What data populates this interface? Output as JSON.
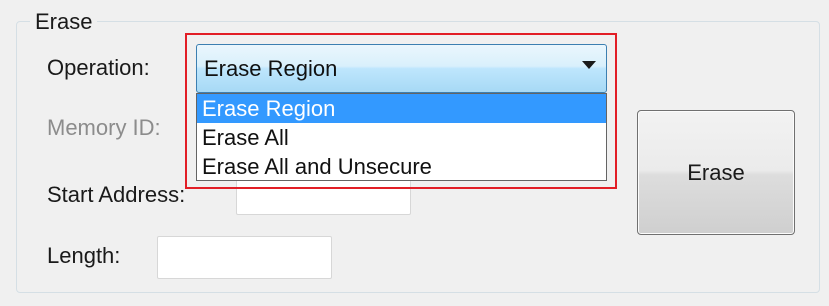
{
  "group": {
    "title": "Erase"
  },
  "fields": {
    "operation_label": "Operation:",
    "memory_id_label": "Memory ID:",
    "start_address_label": "Start Address:",
    "length_label": "Length:",
    "start_address_value": "",
    "length_value": ""
  },
  "operation_select": {
    "selected": "Erase Region",
    "options": [
      "Erase Region",
      "Erase All",
      "Erase All and Unsecure"
    ],
    "highlighted_index": 0
  },
  "buttons": {
    "erase_label": "Erase"
  },
  "colors": {
    "selection": "#3399ff",
    "annotation_box": "#e21e26",
    "combo_border": "#3c7fb1"
  }
}
